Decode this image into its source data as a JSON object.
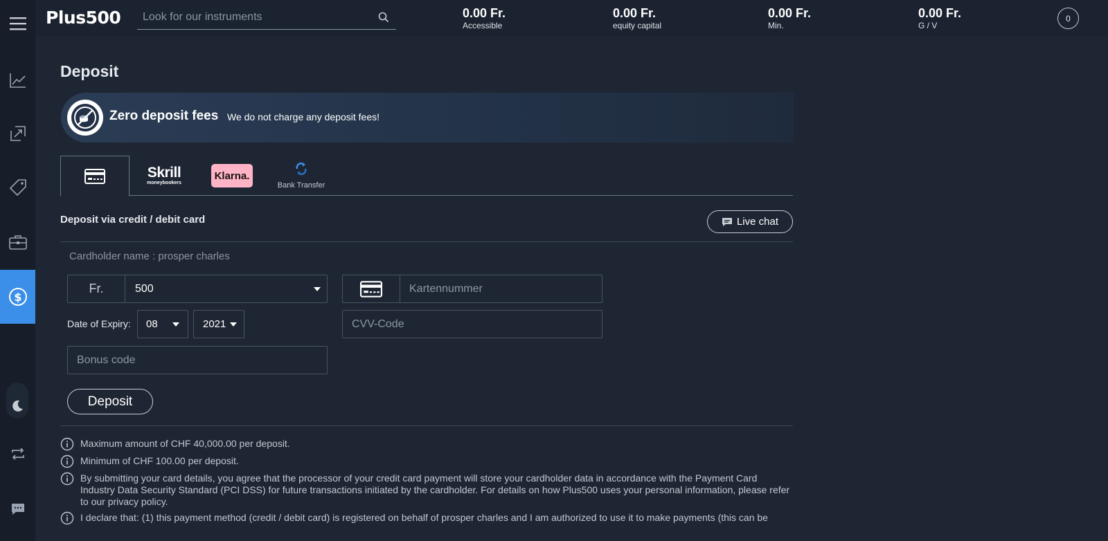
{
  "app": {
    "logo_text": "Plus500"
  },
  "search": {
    "placeholder": "Look for our instruments"
  },
  "stats": [
    {
      "value": "0.00 Fr.",
      "label": "Accessible"
    },
    {
      "value": "0.00 Fr.",
      "label": "equity capital"
    },
    {
      "value": "0.00 Fr.",
      "label": "Min."
    },
    {
      "value": "0.00 Fr.",
      "label": "G / V"
    }
  ],
  "notifications": {
    "count": "0"
  },
  "sidebar": {
    "items": [
      {
        "icon": "chart-line-icon"
      },
      {
        "icon": "trade-arrows-icon"
      },
      {
        "icon": "tag-icon"
      },
      {
        "icon": "briefcase-icon"
      },
      {
        "icon": "dollar-circle-icon",
        "active": true
      },
      {
        "icon": "moon-icon"
      },
      {
        "icon": "swap-icon"
      },
      {
        "icon": "chat-icon"
      }
    ]
  },
  "page": {
    "title": "Deposit"
  },
  "banner": {
    "title": "Zero deposit fees",
    "subtitle": "We do not charge any deposit fees!"
  },
  "tabs": {
    "skrill_name": "Skrill",
    "skrill_sub": "moneybookers",
    "klarna_name": "Klarna.",
    "bank_label": "Bank Transfer"
  },
  "form": {
    "section_title": "Deposit via credit / debit card",
    "live_chat_label": "Live chat",
    "cardholder": "Cardholder name : prosper charles",
    "currency": "Fr.",
    "amount": "500",
    "card_number_placeholder": "Kartennummer",
    "expiry_label": "Date of Expiry:",
    "expiry_month": "08",
    "expiry_year": "2021",
    "cvv_placeholder": "CVV-Code",
    "bonus_placeholder": "Bonus code",
    "deposit_label": "Deposit"
  },
  "notes": [
    "Maximum amount of CHF 40,000.00 per deposit.",
    "Minimum of CHF 100.00 per deposit.",
    "By submitting your card details, you agree that the processor of your credit card payment will store your cardholder data in accordance with the Payment Card Industry Data Security Standard (PCI DSS) for future transactions initiated by the cardholder. For details on how Plus500 uses your personal information, please refer to our privacy policy.",
    "I declare that: (1) this payment method (credit / debit card) is registered on behalf of prosper charles and I am authorized to use it to make payments (this can be"
  ],
  "colors": {
    "background": "#1e2633",
    "sidebar": "#171e29",
    "accent": "#3b8fe8",
    "klarna_pink": "#ffb3c7"
  }
}
